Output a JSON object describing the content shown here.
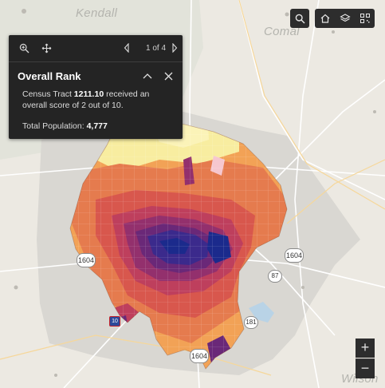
{
  "map": {
    "county_labels": [
      "Kendall",
      "Comal",
      "Wilson"
    ],
    "highway_shields": [
      "1604",
      "1604",
      "87",
      "181",
      "1604",
      "10"
    ]
  },
  "toolbar": {
    "search_icon": "search-icon",
    "home_icon": "home-icon",
    "layers_icon": "layers-icon",
    "qr_icon": "qr-code-icon"
  },
  "popup": {
    "pager": "1 of 4",
    "title": "Overall Rank",
    "body_pre": "Census Tract ",
    "tract": "1211.10",
    "body_post": " received an overall score of 2 out of 10.",
    "pop_label": "Total Population: ",
    "pop_value": "4,777"
  },
  "zoom": {
    "in_label": "+",
    "out_label": "−"
  },
  "colors": {
    "rank_ramp": [
      "#f8eda0",
      "#f7c46c",
      "#f2a256",
      "#e57b4e",
      "#d8574d",
      "#be3f5d",
      "#93306d",
      "#6a2878",
      "#3b2a8c",
      "#1b2a8c"
    ],
    "popup_bg": "#242424",
    "toolbar_bg": "#2d2d2d"
  }
}
